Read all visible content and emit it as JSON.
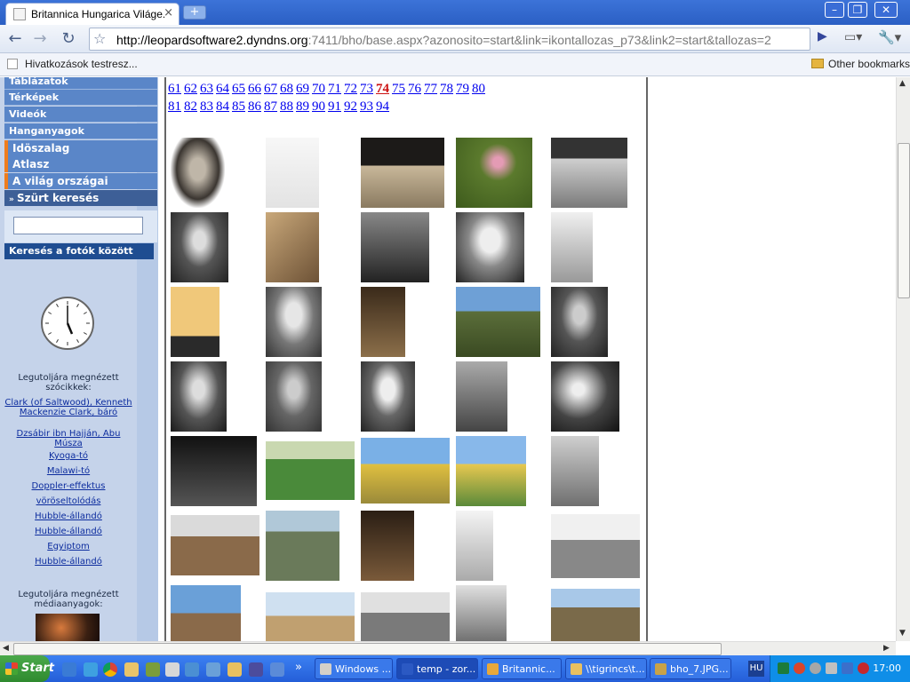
{
  "browser": {
    "tab_title": "Britannica Hungarica Világe...",
    "tab_close": "×",
    "new_tab": "+",
    "url_main": "http://leopardsoftware2.dyndns.org",
    "url_rest": ":7411/bho/base.aspx?azonosito=start&link=ikontallozas_p73&link2=start&tallozas=2",
    "bookmark_custom": "Hivatkozások testresz...",
    "other_bookmarks": "Other bookmarks"
  },
  "sidebar": {
    "menu": [
      {
        "label": "Táblázatok",
        "style": "blue"
      },
      {
        "label": "Térképek",
        "style": "blue"
      },
      {
        "label": "Videók",
        "style": "blue"
      },
      {
        "label": "Hanganyagok",
        "style": "blue"
      },
      {
        "label": "Idöszalag",
        "style": "orange"
      },
      {
        "label": "Atlasz",
        "style": "orange"
      },
      {
        "label": "A világ országai",
        "style": "orange"
      },
      {
        "label": "Szürt keresés",
        "style": "filter"
      }
    ],
    "filter_prefix": "»",
    "photo_search_label": "Keresés a fotók között",
    "recent_articles_title": "Legutoljára megnézett szócikkek:",
    "recent_articles": [
      "Clark (of Saltwood), Kenneth Mackenzie Clark, báró",
      "Dzsábir ibn Hajján, Abu Músza",
      "Kyoga-tó",
      "Malawi-tó",
      "Doppler-effektus",
      "vöröseltolódás",
      "Hubble-állandó",
      "Hubble-állandó",
      "Egyiptom",
      "Hubble-állandó"
    ],
    "recent_media_title": "Legutoljára megnézett médiaanyagok:"
  },
  "pagination": {
    "row1": [
      "61",
      "62",
      "63",
      "64",
      "65",
      "66",
      "67",
      "68",
      "69",
      "70",
      "71",
      "72",
      "73",
      "74",
      "75",
      "76",
      "77",
      "78",
      "79",
      "80"
    ],
    "row2": [
      "81",
      "82",
      "83",
      "84",
      "85",
      "86",
      "87",
      "88",
      "89",
      "90",
      "91",
      "92",
      "93",
      "94"
    ],
    "current": "74"
  },
  "taskbar": {
    "start": "Start",
    "more": "»",
    "tasks": [
      {
        "label": "Windows ...",
        "icon": "#d4d0c8"
      },
      {
        "label": "temp - zor...",
        "icon": "#2b59c3"
      },
      {
        "label": "Britannic...",
        "icon": "#e7a83b"
      },
      {
        "label": "\\\\tigrincs\\t...",
        "icon": "#e8c060"
      },
      {
        "label": "bho_7.JPG...",
        "icon": "#c8a248"
      }
    ],
    "language": "HU",
    "time": "17:00"
  },
  "colors": {
    "menu_blue": "#5a86c8",
    "accent_orange": "#ef7d1d",
    "link_blue": "#0000ee",
    "current_page_red": "#cc1111"
  }
}
